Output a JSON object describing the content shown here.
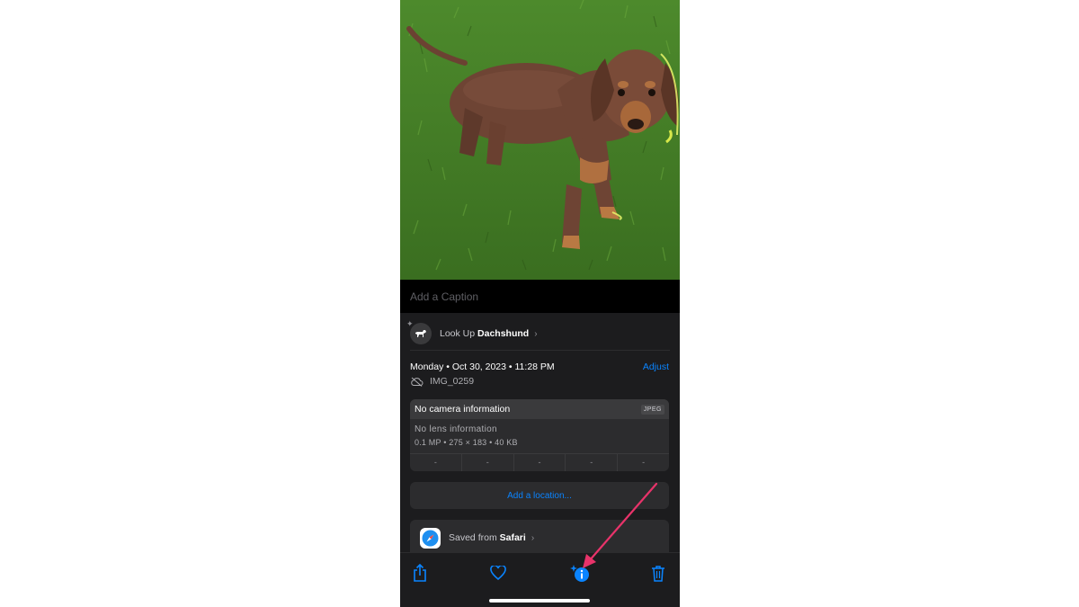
{
  "caption": {
    "placeholder": "Add a Caption"
  },
  "lookup": {
    "prefix": "Look Up",
    "subject": "Dachshund",
    "chevron": "›"
  },
  "photo_info": {
    "date": "Monday • Oct 30, 2023 • 11:28 PM",
    "adjust_label": "Adjust",
    "filename": "IMG_0259"
  },
  "camera": {
    "title": "No camera information",
    "format": "JPEG",
    "lens": "No lens information",
    "spec": "0.1 MP  •  275 × 183  •  40 KB",
    "exif": [
      "-",
      "-",
      "-",
      "-",
      "-"
    ]
  },
  "location": {
    "label": "Add a location..."
  },
  "saved": {
    "prefix": "Saved from",
    "source": "Safari",
    "chevron": "›"
  },
  "toolbar": {
    "icons": [
      "share-icon",
      "heart-icon",
      "info-sparkle-icon",
      "trash-icon"
    ]
  },
  "colors": {
    "accent": "#0a84ff",
    "background": "#1c1c1e",
    "arrow": "#e8336a"
  }
}
